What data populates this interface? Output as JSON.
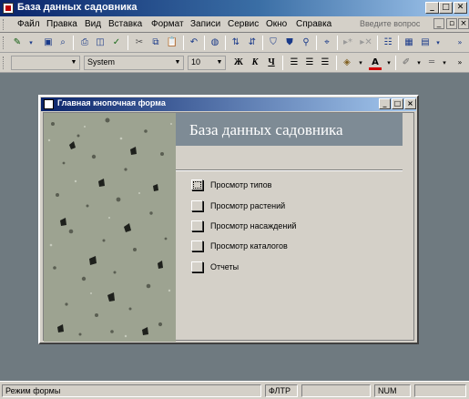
{
  "window": {
    "title": "База данных садовника",
    "minimize": "_",
    "maximize": "□",
    "close": "✕"
  },
  "menu": {
    "items": [
      "Файл",
      "Правка",
      "Вид",
      "Вставка",
      "Формат",
      "Записи",
      "Сервис",
      "Окно",
      "Справка"
    ],
    "ask_placeholder": "Введите вопрос"
  },
  "formatting": {
    "object_combo": "",
    "font_combo": "System",
    "size_combo": "10",
    "bold": "Ж",
    "italic": "К",
    "underline": "Ч"
  },
  "form": {
    "title": "Главная кнопочная форма",
    "header_title": "База данных садовника",
    "buttons": [
      {
        "label": "Просмотр типов"
      },
      {
        "label": "Просмотр растений"
      },
      {
        "label": "Просмотр насаждений"
      },
      {
        "label": "Просмотр каталогов"
      },
      {
        "label": "Отчеты"
      }
    ]
  },
  "status": {
    "mode": "Режим формы",
    "fltr": "ФЛТР",
    "num": "NUM"
  },
  "colors": {
    "title_gradient_start": "#0a246a",
    "desktop": "#6f7a80",
    "header_band": "#7e8b95",
    "face": "#d4d0c8"
  }
}
